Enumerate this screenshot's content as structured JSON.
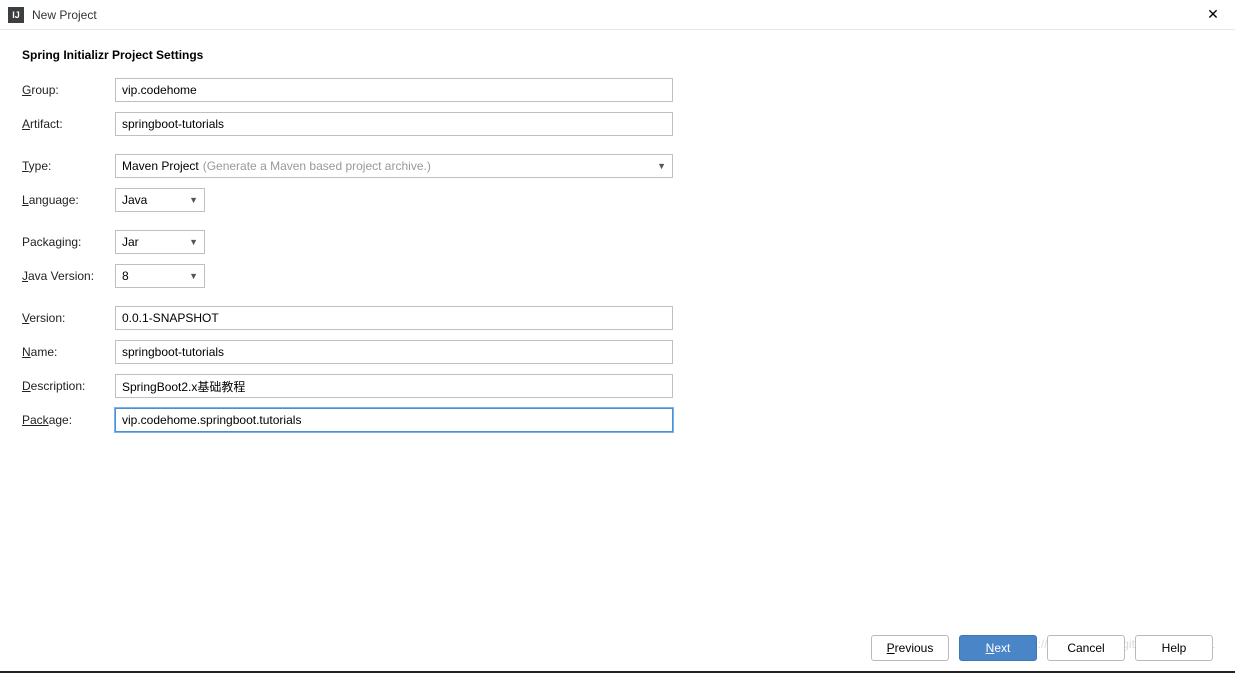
{
  "window": {
    "title": "New Project",
    "app_icon_text": "IJ"
  },
  "heading": "Spring Initializr Project Settings",
  "labels": {
    "group": "roup:",
    "group_mnemonic": "G",
    "artifact": "rtifact:",
    "artifact_mnemonic": "A",
    "type": "ype:",
    "type_mnemonic": "T",
    "language": "anguage:",
    "language_mnemonic": "L",
    "packaging": "Packaging:",
    "java_version": "ava Version:",
    "java_version_mnemonic": "J",
    "version": "ersion:",
    "version_mnemonic": "V",
    "name": "ame:",
    "name_mnemonic": "N",
    "description": "escription:",
    "description_mnemonic": "D",
    "package": "age:",
    "package_mnemonic": "Pack"
  },
  "fields": {
    "group": "vip.codehome",
    "artifact": "springboot-tutorials",
    "type_selected": "Maven Project",
    "type_hint": "(Generate a Maven based project archive.)",
    "language": "Java",
    "packaging": "Jar",
    "java_version": "8",
    "version": "0.0.1-SNAPSHOT",
    "name": "springboot-tutorials",
    "description": "SpringBoot2.x基础教程",
    "package": "vip.codehome.springboot.tutorials"
  },
  "buttons": {
    "previous": "revious",
    "previous_mnemonic": "P",
    "next": "ext",
    "next_mnemonic": "N",
    "cancel": "Cancel",
    "help": "Help"
  },
  "watermark": "https://blog.csdn.net/github_35592621"
}
